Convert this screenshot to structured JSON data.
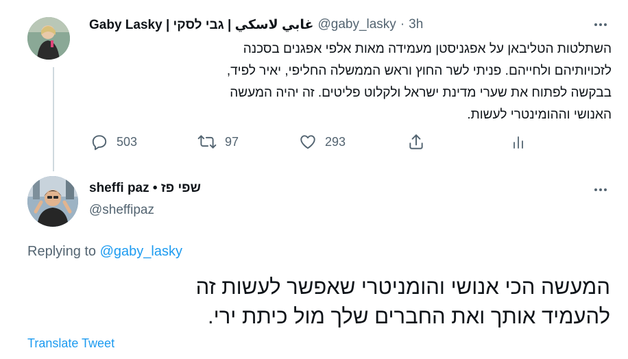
{
  "tweet1": {
    "author_name": "Gaby Lasky | غابي لاسكي | גבי לסקי",
    "handle": "@gaby_lasky",
    "time": "3h",
    "separator": "·",
    "text_lines": [
      "השתלטות הטליבאן על אפגניסטן מעמידה מאות אלפי אפגנים בסכנה",
      "לזכויותיהם ולחייהם. פניתי לשר החוץ וראש הממשלה החליפי, יאיר לפיד,",
      "בבקשה לפתוח את שערי מדינת ישראל ולקלוט פליטים. זה יהיה המעשה",
      "האנושי וההומינטרי לעשות."
    ],
    "actions": {
      "reply_count": "503",
      "retweet_count": "97",
      "like_count": "293"
    }
  },
  "tweet2": {
    "author_name": "sheffi paz • שפי פז",
    "handle": "@sheffipaz",
    "replying_prefix": "Replying to",
    "replying_handle": "@gaby_lasky",
    "text_lines": [
      "המעשה הכי אנושי והומניטרי שאפשר לעשות זה",
      "להעמיד אותך ואת החברים שלך מול כיתת ירי."
    ],
    "translate_label": "Translate Tweet"
  },
  "icons": {
    "reply": "reply-icon",
    "retweet": "retweet-icon",
    "like": "heart-icon",
    "share": "share-icon",
    "analytics": "analytics-icon",
    "more": "more-icon"
  },
  "colors": {
    "link": "#1d9bf0",
    "secondary_text": "#536471",
    "primary_text": "#0f1419",
    "thread_line": "#cfd9de"
  }
}
